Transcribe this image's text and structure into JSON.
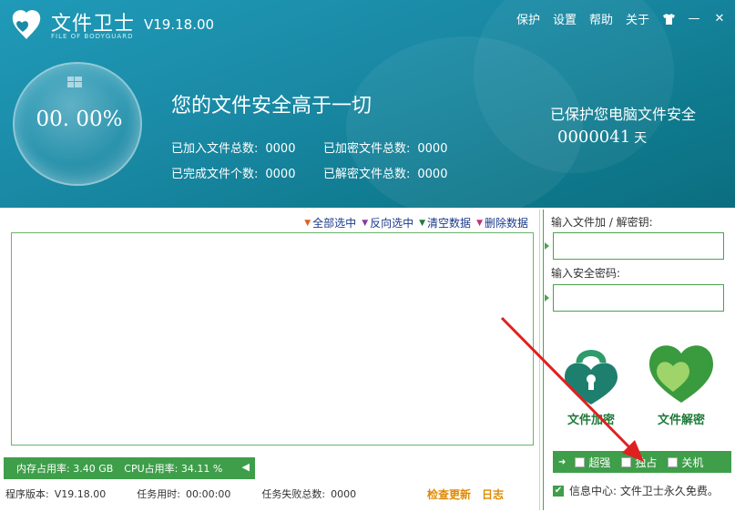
{
  "header": {
    "app_title": "文件卫士",
    "app_subtitle": "FILE OF BODYGUARD",
    "version": "V19.18.00",
    "menu": [
      "保护",
      "设置",
      "帮助",
      "关于"
    ],
    "shirt_icon": "shirt-icon",
    "minimize_glyph": "—",
    "close_glyph": "✕",
    "progress_text": "00. 00%",
    "slogan": "您的文件安全高于一切",
    "stats": {
      "added_label": "已加入文件总数:",
      "added_value": "0000",
      "encrypted_label": "已加密文件总数:",
      "encrypted_value": "0000",
      "completed_label": "已完成文件个数:",
      "completed_value": "0000",
      "decrypted_label": "已解密文件总数:",
      "decrypted_value": "0000"
    },
    "protected_label": "已保护您电脑文件安全",
    "protected_days": "0000041",
    "protected_unit": "天"
  },
  "actions": {
    "select_all": "全部选中",
    "invert": "反向选中",
    "clear": "清空数据",
    "delete": "删除数据"
  },
  "membar": {
    "mem_label": "内存占用率:",
    "mem_value": "3.40 GB",
    "cpu_label": "CPU占用率:",
    "cpu_value": "34.11 %"
  },
  "status": {
    "version_label": "程序版本:",
    "version_value": "V19.18.00",
    "time_label": "任务用时:",
    "time_value": "00:00:00",
    "fail_label": "任务失败总数:",
    "fail_value": "0000",
    "update_link": "检查更新",
    "log_link": "日志"
  },
  "right": {
    "key_label": "输入文件加 / 解密钥:",
    "pwd_label": "输入安全密码:",
    "encrypt_label": "文件加密",
    "decrypt_label": "文件解密",
    "options": [
      "超强",
      "独占",
      "关机"
    ],
    "info_text": "信息中心: 文件卫士永久免费。"
  },
  "colors": {
    "header": "#1a8aa6",
    "accent_green": "#3f9e4a",
    "link_orange": "#e08a00",
    "annotation_red": "#e02020"
  }
}
